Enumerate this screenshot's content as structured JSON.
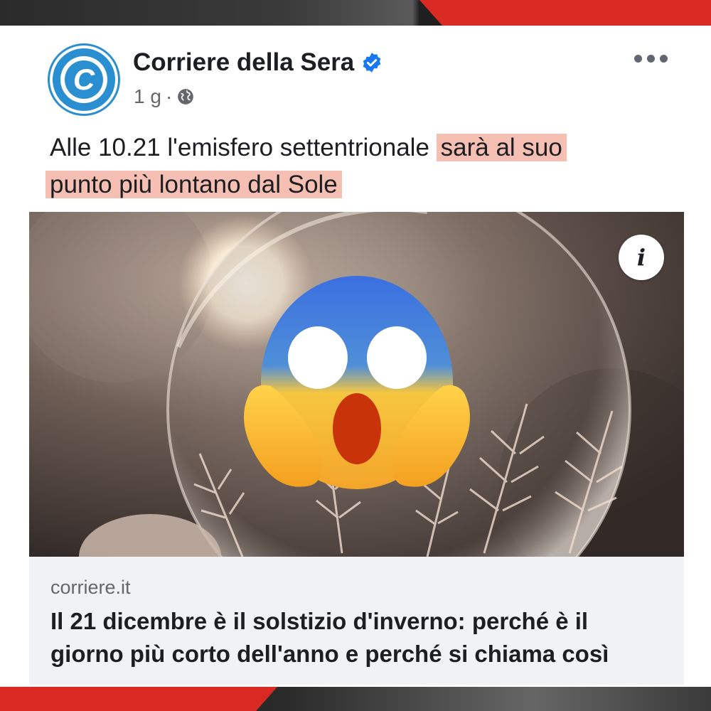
{
  "post": {
    "author": "Corriere della Sera",
    "timestamp": "1 g",
    "separator": "·",
    "text_plain": "Alle 10.21 l'emisfero settentrionale ",
    "text_highlight_1": "sarà al suo",
    "text_highlight_2": "punto più lontano dal Sole",
    "highlight_color": "#f6bfb3"
  },
  "icons": {
    "logo": "corriere-c-logo",
    "verified": "verified-badge-icon",
    "audience": "globe-icon",
    "more": "more-options-icon",
    "info": "info-icon",
    "overlay_emoji": "face-screaming-in-fear-emoji"
  },
  "link_preview": {
    "domain": "corriere.it",
    "headline": "Il 21 dicembre è il solstizio d'inverno: perché è il giorno più corto dell'anno e perché si chiama così"
  },
  "image": {
    "info_label": "i"
  },
  "colors": {
    "brand_blue": "#2a8fd0",
    "verified_blue": "#1877f2",
    "frame_red": "#d82a22"
  }
}
